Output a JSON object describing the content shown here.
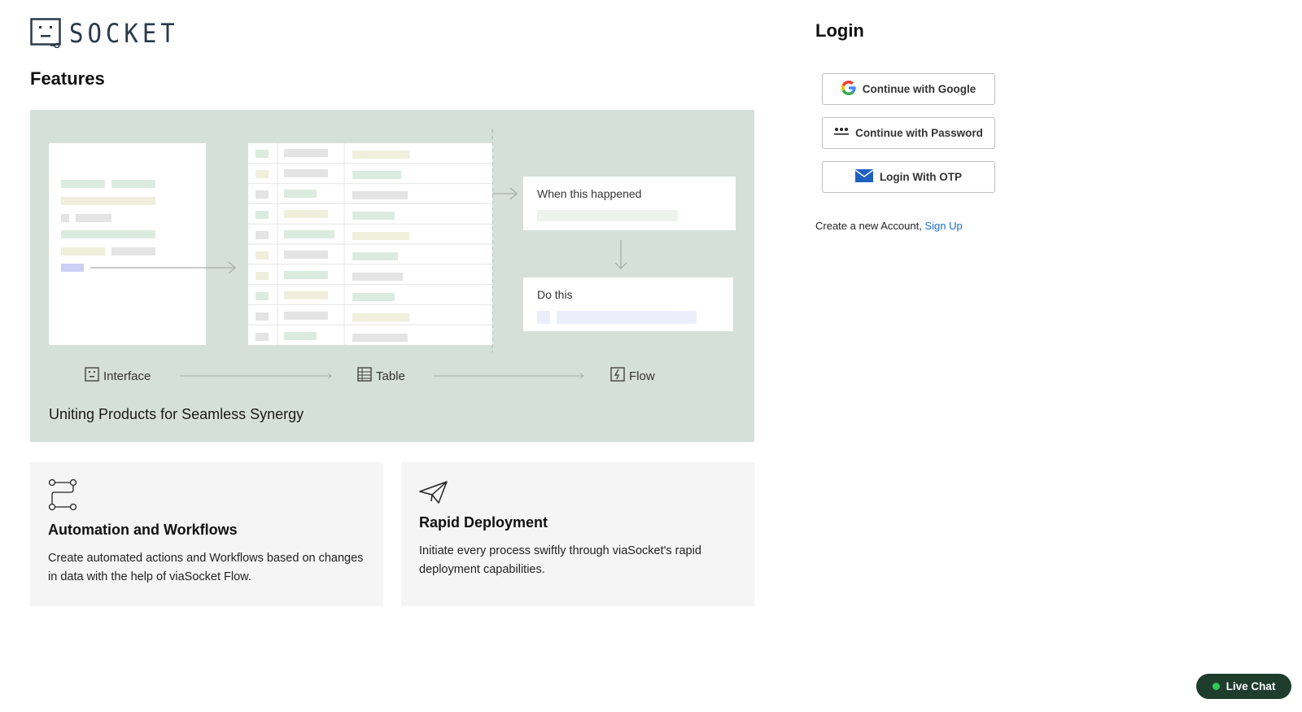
{
  "brand": {
    "name": "SOCKET"
  },
  "features": {
    "title": "Features",
    "hero": {
      "caption": "Uniting Products for Seamless Synergy",
      "trigger_label": "When this happened",
      "action_label": "Do this",
      "steps": [
        {
          "label": "Interface",
          "icon": "interface-icon"
        },
        {
          "label": "Table",
          "icon": "table-icon"
        },
        {
          "label": "Flow",
          "icon": "flow-icon"
        }
      ]
    },
    "cards": [
      {
        "icon": "workflow-icon",
        "title": "Automation and Workflows",
        "text": "Create automated actions and Workflows based on changes in data with the help of viaSocket Flow."
      },
      {
        "icon": "paper-plane-icon",
        "title": "Rapid Deployment",
        "text": "Initiate every process swiftly through viaSocket's rapid deployment capabilities."
      }
    ]
  },
  "login": {
    "title": "Login",
    "google_label": "Continue with Google",
    "password_label": "Continue with Password",
    "otp_label": "Login With OTP",
    "signup_prefix": "Create a new Account,",
    "signup_link": "Sign Up"
  },
  "live_chat": {
    "label": "Live Chat"
  },
  "colors": {
    "hero_bg": "#d6e0da",
    "card_bg": "#f5f5f5",
    "link": "#1a6fd0",
    "chat_bg": "#1f3d2d",
    "chat_dot": "#2ecc55"
  }
}
